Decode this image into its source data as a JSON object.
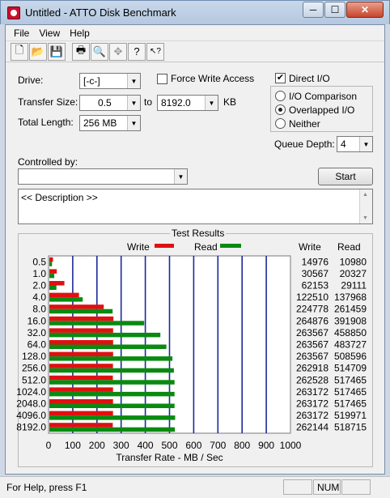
{
  "window": {
    "title": "Untitled - ATTO Disk Benchmark",
    "min_glyph": "─",
    "max_glyph": "☐",
    "close_glyph": "✕"
  },
  "menu": [
    "File",
    "View",
    "Help"
  ],
  "toolbar": [
    {
      "name": "new-file-icon",
      "glyph": "🗋"
    },
    {
      "name": "open-folder-icon",
      "glyph": "📂"
    },
    {
      "name": "save-icon",
      "glyph": "💾"
    },
    {
      "name": "print-icon",
      "glyph": "🖶"
    },
    {
      "name": "print-preview-icon",
      "glyph": "🔍"
    },
    {
      "name": "move-icon",
      "glyph": "✥"
    },
    {
      "name": "help-icon",
      "glyph": "?"
    },
    {
      "name": "context-help-icon",
      "glyph": "↖?"
    }
  ],
  "form": {
    "drive_label": "Drive:",
    "drive_value": "[-c-]",
    "force_write_label": "Force Write Access",
    "direct_io_label": "Direct I/O",
    "direct_io_checked": "✔",
    "transfer_size_label": "Transfer Size:",
    "transfer_from": "0.5",
    "to_label": "to",
    "transfer_to": "8192.0",
    "kb_label": "KB",
    "total_length_label": "Total Length:",
    "total_length_value": "256 MB",
    "io_comparison_label": "I/O Comparison",
    "overlapped_io_label": "Overlapped I/O",
    "neither_label": "Neither",
    "queue_depth_label": "Queue Depth:",
    "queue_depth_value": "4",
    "controlled_by_label": "Controlled by:",
    "controlled_by_value": "",
    "start_label": "Start",
    "description_text": "<< Description >>"
  },
  "results": {
    "title": "Test Results",
    "write_col": "Write",
    "read_col": "Read"
  },
  "chart_data": {
    "type": "bar",
    "orientation": "horizontal",
    "title": "Test Results",
    "xlabel": "Transfer Rate - MB / Sec",
    "xlim": [
      0,
      1000
    ],
    "xticks": [
      "0",
      "100",
      "200",
      "300",
      "400",
      "500",
      "600",
      "700",
      "800",
      "900",
      "1000"
    ],
    "categories": [
      "0.5",
      "1.0",
      "2.0",
      "4.0",
      "8.0",
      "16.0",
      "32.0",
      "64.0",
      "128.0",
      "256.0",
      "512.0",
      "1024.0",
      "2048.0",
      "4096.0",
      "8192.0"
    ],
    "series": [
      {
        "name": "Write",
        "color": "#e01010",
        "values": [
          14.976,
          30.567,
          62.153,
          122.51,
          224.778,
          264.876,
          263.567,
          263.567,
          263.567,
          262.918,
          262.528,
          263.172,
          263.172,
          263.172,
          262.144
        ],
        "labels": [
          "14976",
          "30567",
          "62153",
          "122510",
          "224778",
          "264876",
          "263567",
          "263567",
          "263567",
          "262918",
          "262528",
          "263172",
          "263172",
          "263172",
          "262144"
        ]
      },
      {
        "name": "Read",
        "color": "#0a8a10",
        "values": [
          10.98,
          20.327,
          29.111,
          137.968,
          261.459,
          391.908,
          458.85,
          483.727,
          508.596,
          514.709,
          517.465,
          517.465,
          517.465,
          519.971,
          518.715
        ],
        "labels": [
          "10980",
          "20327",
          "29111",
          "137968",
          "261459",
          "391908",
          "458850",
          "483727",
          "508596",
          "514709",
          "517465",
          "517465",
          "517465",
          "519971",
          "518715"
        ]
      }
    ],
    "grid_color": "#1b2a9a"
  },
  "status": {
    "help_text": "For Help, press F1",
    "num": "NUM"
  }
}
